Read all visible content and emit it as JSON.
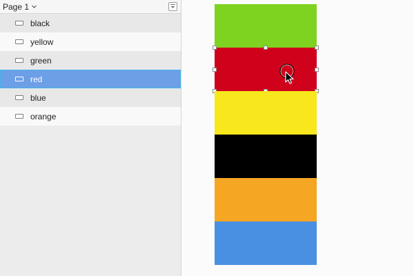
{
  "page": {
    "name": "Page 1",
    "icons": {
      "dropdown": "chevron-down-icon",
      "menu": "page-menu-icon"
    }
  },
  "layers": [
    {
      "name": "black",
      "icon": "rectangle-icon",
      "selected": false
    },
    {
      "name": "yellow",
      "icon": "rectangle-icon",
      "selected": false
    },
    {
      "name": "green",
      "icon": "rectangle-icon",
      "selected": false
    },
    {
      "name": "red",
      "icon": "rectangle-icon",
      "selected": true
    },
    {
      "name": "blue",
      "icon": "rectangle-icon",
      "selected": false
    },
    {
      "name": "orange",
      "icon": "rectangle-icon",
      "selected": false
    }
  ],
  "canvas": {
    "stack_order_top_to_bottom": [
      "green",
      "red",
      "yellow",
      "black",
      "orange",
      "blue"
    ],
    "colors": {
      "green": "#7ed321",
      "red": "#d0021b",
      "yellow": "#f8e71c",
      "black": "#000000",
      "orange": "#f5a623",
      "blue": "#4a90e2"
    },
    "selected": "red"
  },
  "theme": {
    "selection_fill": "#6d9fe6",
    "selection_outline": "#3fb5ec"
  }
}
